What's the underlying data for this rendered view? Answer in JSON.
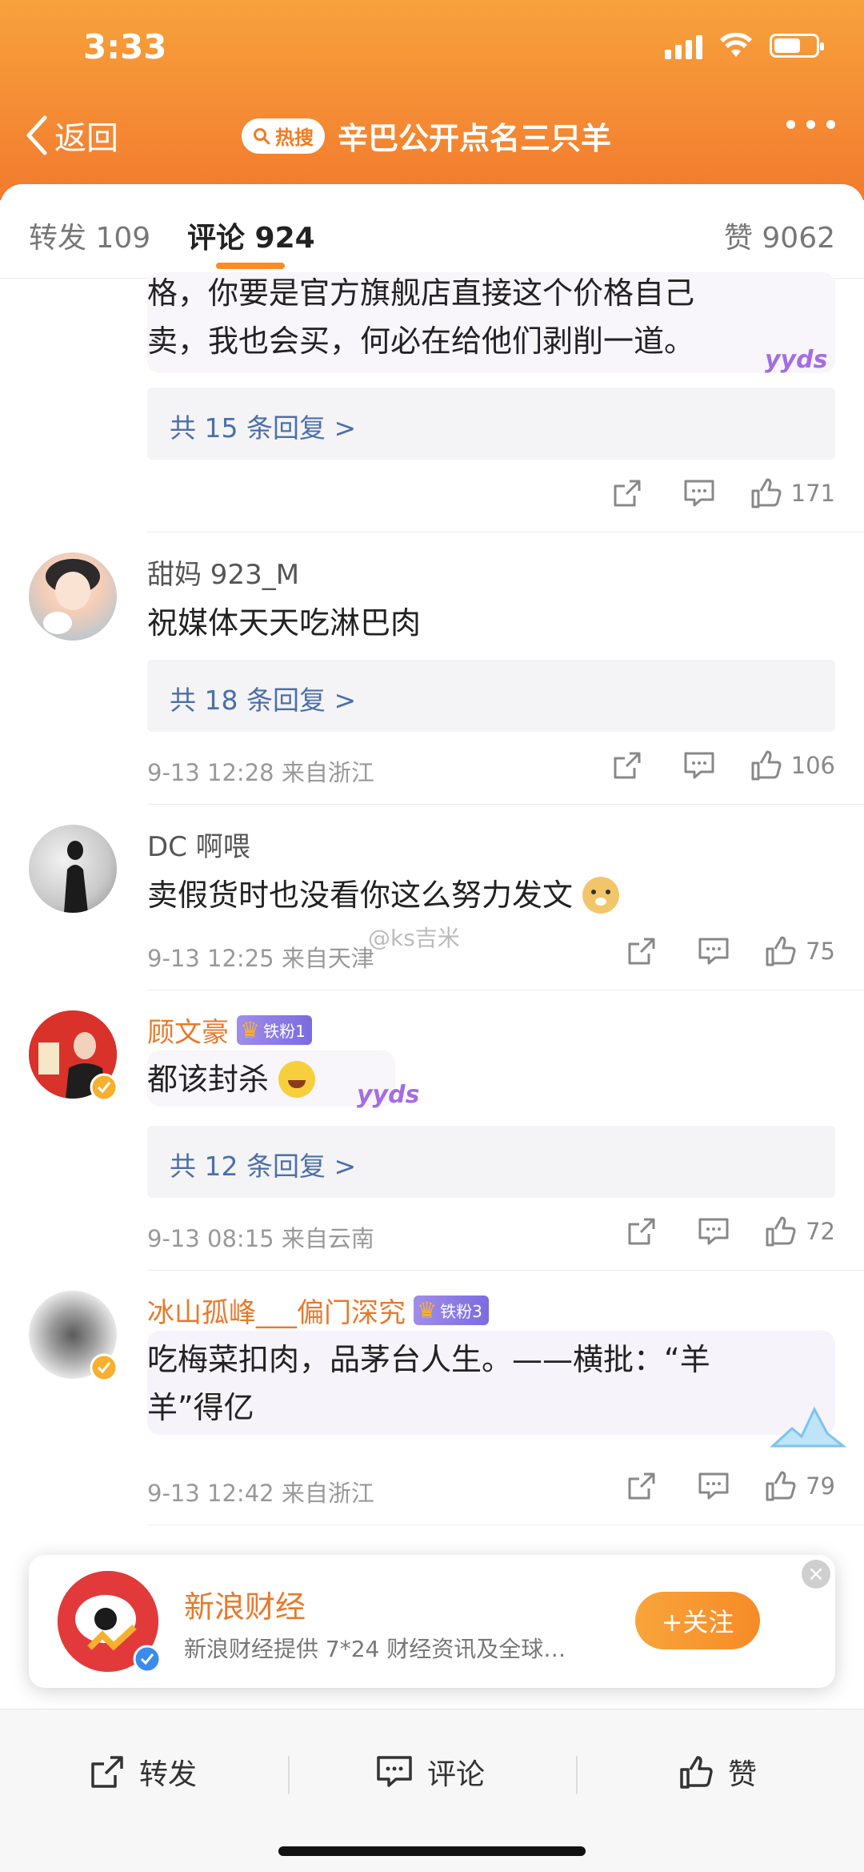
{
  "status_bar": {
    "time": "3:33"
  },
  "nav": {
    "back_label": "返回",
    "hot_badge": "热搜",
    "title": "辛巴公开点名三只羊"
  },
  "tabs": {
    "repost": "转发 109",
    "comment": "评论 924",
    "like": "赞 9062"
  },
  "comments": [
    {
      "text_lines": [
        "格，你要是官方旗舰店直接这个价格自己",
        "卖，我也会买，何必在给他们剥削一道。"
      ],
      "replies": "共 15 条回复 >",
      "likes": "171"
    },
    {
      "username": "甜妈 923_M",
      "text": "祝媒体天天吃淋巴肉",
      "replies": "共 18 条回复 >",
      "meta": "9-13 12:28  来自浙江",
      "likes": "106"
    },
    {
      "username": "DC 啊喂",
      "text": "卖假货时也没看你这么努力发文",
      "meta": "9-13 12:25  来自天津",
      "likes": "75"
    },
    {
      "username": "顾文豪",
      "badge": "铁粉1",
      "text": "都该封杀",
      "replies": "共 12 条回复 >",
      "meta": "9-13 08:15  来自云南",
      "likes": "72"
    },
    {
      "username": "冰山孤峰___偏门深究",
      "badge": "铁粉3",
      "text_lines": [
        "吃梅菜扣肉，品茅台人生。——横批：“羊",
        "羊”得亿"
      ],
      "meta": "9-13 12:42  来自浙江",
      "likes": "79"
    }
  ],
  "watermark": "@ks吉米",
  "promo": {
    "name": "新浪财经",
    "description": "新浪财经提供 7*24 财经资讯及全球…",
    "follow_label": "+关注"
  },
  "bottom_bar": {
    "repost": "转发",
    "comment": "评论",
    "like": "赞"
  },
  "colors": {
    "header_orange": "#f27a2e",
    "accent": "#f98c26",
    "link_blue": "#4d6fa8",
    "vip_orange": "#e8792c"
  }
}
